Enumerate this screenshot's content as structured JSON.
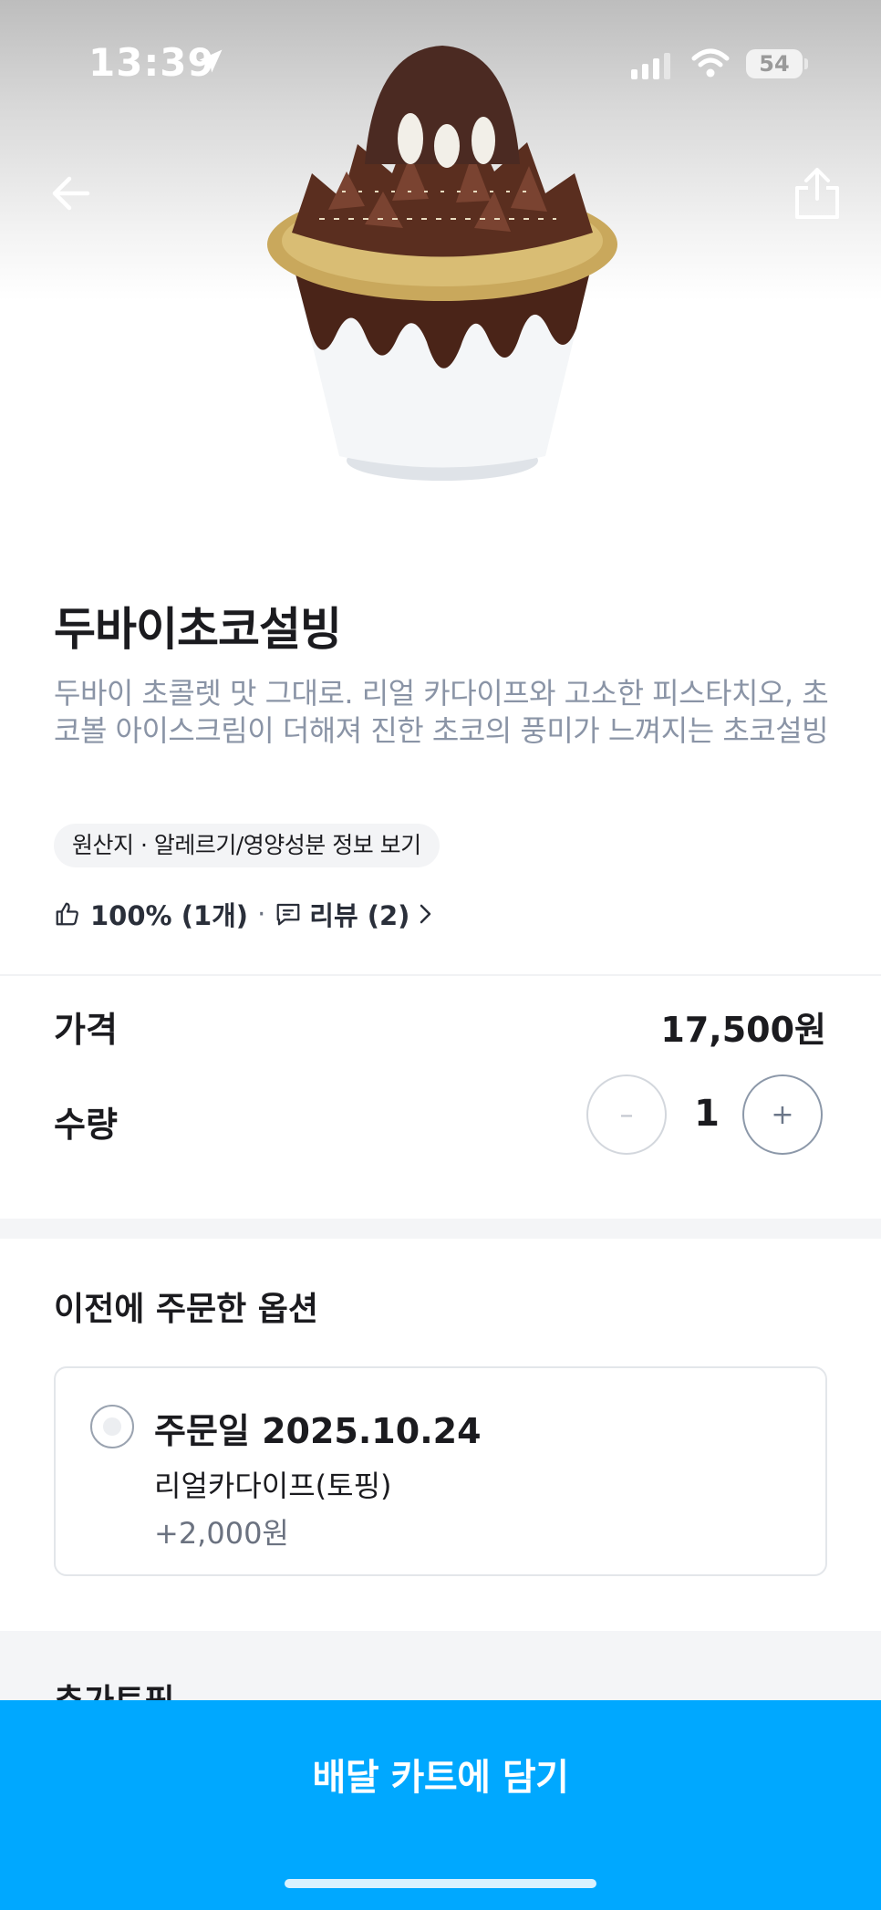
{
  "status_bar": {
    "time": "13:39",
    "battery": "54"
  },
  "product": {
    "title": "두바이초코설빙",
    "description": "두바이 초콜렛 맛 그대로. 리얼 카다이프와 고소한 피스타치오, 초코볼 아이스크림이 더해져 진한 초코의 풍미가 느껴지는 초코설빙",
    "info_chip": "원산지 · 알레르기/영양성분 정보 보기",
    "rating": "100% (1개)",
    "separator": "·",
    "review": "리뷰 (2)"
  },
  "price_row": {
    "label": "가격",
    "value": "17,500원"
  },
  "quantity_row": {
    "label": "수량",
    "minus": "–",
    "plus": "+",
    "value": "1"
  },
  "previous_options": {
    "title": "이전에 주문한 옵션",
    "card": {
      "order_date": "주문일 2025.10.24",
      "option_name": "리얼카다이프(토핑)",
      "option_price": "+2,000원"
    }
  },
  "extra_toppings": {
    "title": "추가토핑"
  },
  "cta": {
    "label": "배달 카트에 담기"
  },
  "colors": {
    "accent": "#00a8ff",
    "description": "#8a94a6",
    "text": "#1b1b1f"
  },
  "icons": [
    "location-arrow-icon",
    "signal-icon",
    "wifi-icon",
    "battery-icon",
    "back-arrow-icon",
    "share-icon",
    "thumbs-up-icon",
    "comment-icon",
    "chevron-right-icon",
    "minus-icon",
    "plus-icon",
    "radio-icon"
  ]
}
